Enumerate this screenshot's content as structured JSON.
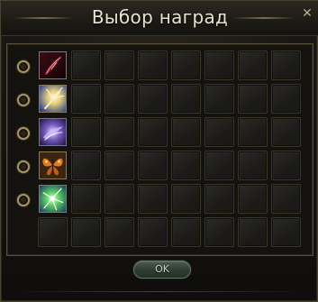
{
  "window": {
    "title": "Выбор наград",
    "close_glyph": "✕",
    "ok_label": "OK"
  },
  "rewards": [
    {
      "icon": "red-feather-quill-icon",
      "accent": "#8b1c2a"
    },
    {
      "icon": "golden-sword-burst-icon",
      "accent": "#e6d48a"
    },
    {
      "icon": "purple-wing-icon",
      "accent": "#7a5fc4"
    },
    {
      "icon": "orange-butterfly-wings-icon",
      "accent": "#e07a1e"
    },
    {
      "icon": "green-lightning-burst-icon",
      "accent": "#5fd16a"
    }
  ],
  "grid": {
    "rows": 6,
    "columns": 8,
    "icon_rows": 5
  }
}
